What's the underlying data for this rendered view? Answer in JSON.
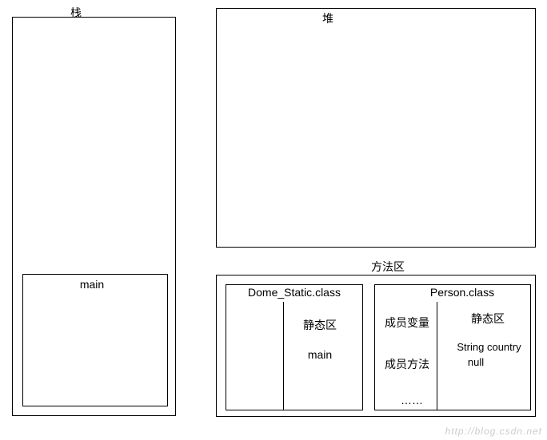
{
  "stack": {
    "title": "栈",
    "main_label": "main"
  },
  "heap": {
    "title": "堆"
  },
  "method_area": {
    "title": "方法区",
    "dome": {
      "title": "Dome_Static.class",
      "static_label": "静态区",
      "main_label": "main"
    },
    "person": {
      "title": "Person.class",
      "static_label": "静态区",
      "members_label": "成员变量",
      "methods_label": "成员方法",
      "ellipsis": "……",
      "field_type": "String country",
      "field_value": "null"
    }
  },
  "watermark": "http://blog.csdn.net"
}
